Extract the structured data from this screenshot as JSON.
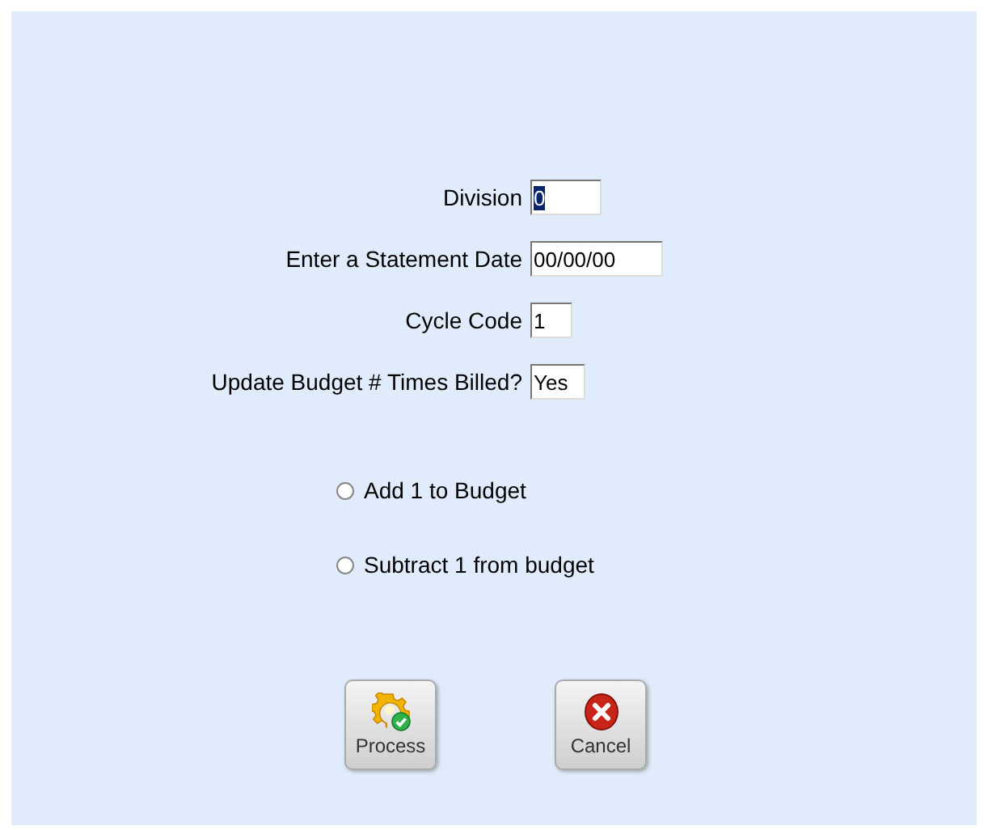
{
  "fields": [
    {
      "label": "Division",
      "value": "0",
      "value_selected": true
    },
    {
      "label": "Enter a Statement Date",
      "value": "00/00/00",
      "value_selected": false
    },
    {
      "label": "Cycle Code",
      "value": "1",
      "value_selected": false
    },
    {
      "label": "Update Budget # Times Billed?",
      "value": "Yes",
      "value_selected": false
    }
  ],
  "options": [
    {
      "label": "Add 1 to Budget",
      "selected": false
    },
    {
      "label": "Subtract 1 from budget",
      "selected": false
    }
  ],
  "buttons": [
    {
      "label": "Process",
      "kind": "process"
    },
    {
      "label": "Cancel",
      "kind": "cancel"
    }
  ]
}
